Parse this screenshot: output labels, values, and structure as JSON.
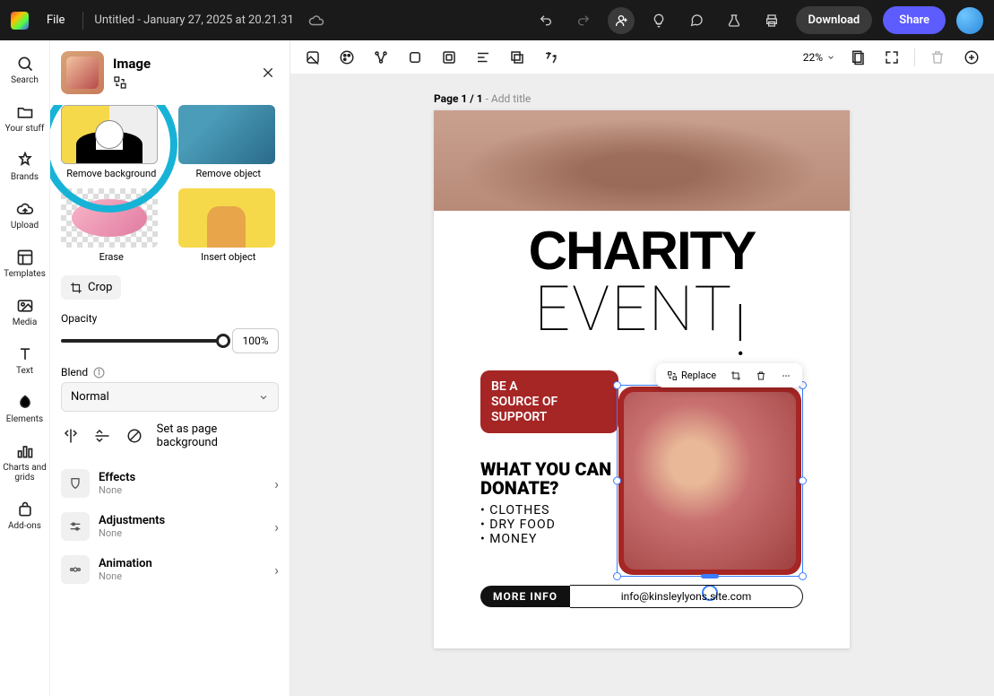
{
  "topbar": {
    "file_label": "File",
    "title": "Untitled - January 27, 2025 at 20.21.31",
    "download_label": "Download",
    "share_label": "Share"
  },
  "rail": {
    "items": [
      {
        "label": "Search",
        "icon": "search-icon"
      },
      {
        "label": "Your stuff",
        "icon": "folder-icon"
      },
      {
        "label": "Brands",
        "icon": "brand-icon"
      },
      {
        "label": "Upload",
        "icon": "upload-icon"
      },
      {
        "label": "Templates",
        "icon": "templates-icon"
      },
      {
        "label": "Media",
        "icon": "media-icon"
      },
      {
        "label": "Text",
        "icon": "text-icon"
      },
      {
        "label": "Elements",
        "icon": "elements-icon"
      },
      {
        "label": "Charts and grids",
        "icon": "charts-icon"
      },
      {
        "label": "Add-ons",
        "icon": "addons-icon"
      }
    ]
  },
  "panel": {
    "title": "Image",
    "actions": {
      "remove_background": "Remove background",
      "remove_object": "Remove object",
      "erase": "Erase",
      "insert_object": "Insert object"
    },
    "crop_label": "Crop",
    "opacity_label": "Opacity",
    "opacity_value": "100%",
    "blend_label": "Blend",
    "blend_value": "Normal",
    "page_bg_label": "Set as page background",
    "rows": {
      "effects": {
        "title": "Effects",
        "sub": "None"
      },
      "adjustments": {
        "title": "Adjustments",
        "sub": "None"
      },
      "animation": {
        "title": "Animation",
        "sub": "None"
      }
    }
  },
  "contextbar": {
    "zoom": "22%"
  },
  "canvas": {
    "page_prefix": "Page 1 / 1",
    "page_suffix": " - Add title",
    "headline1": "CHARITY",
    "headline2": "EVENT",
    "redbox_l1": "BE A",
    "redbox_l2": "SOURCE OF",
    "redbox_l3": "SUPPORT",
    "donate_h": "WHAT YOU CAN DONATE?",
    "donate_items": [
      "CLOTHES",
      "DRY FOOD",
      "MONEY"
    ],
    "more_info": "MORE INFO",
    "email": "info@kinsleylyons.site.com",
    "float_replace": "Replace"
  }
}
